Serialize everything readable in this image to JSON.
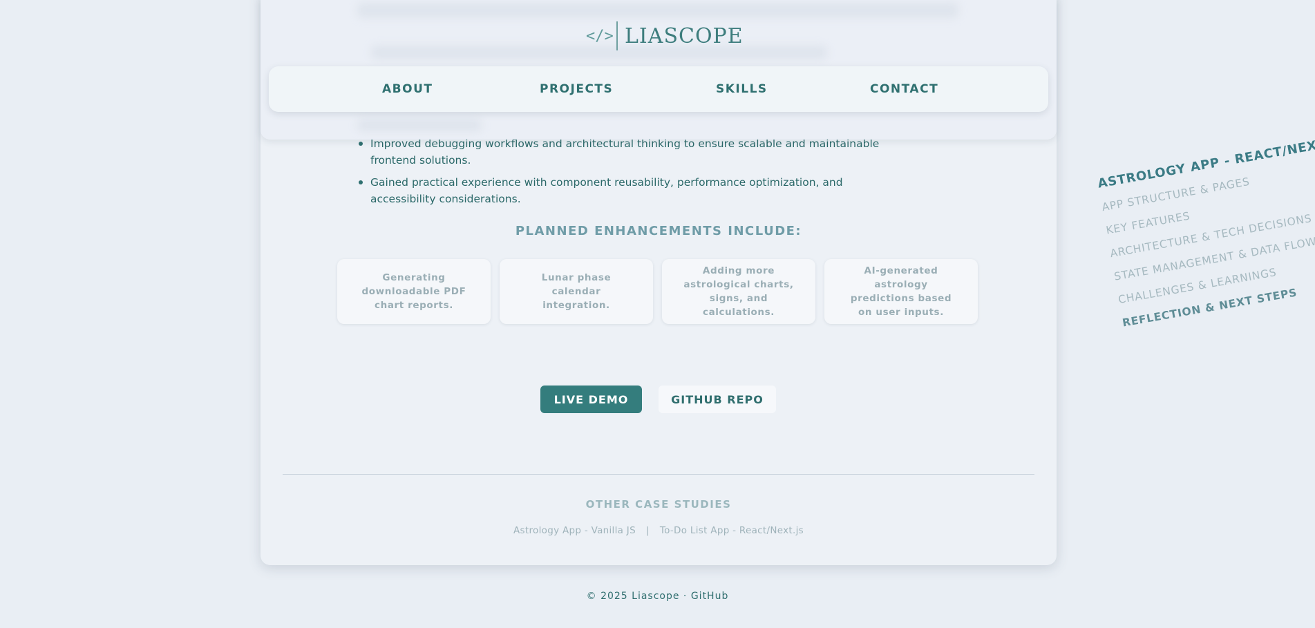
{
  "header": {
    "logo_icon": "</>",
    "logo_text": "LIASCOPE"
  },
  "nav": {
    "items": [
      {
        "label": "ABOUT"
      },
      {
        "label": "PROJECTS"
      },
      {
        "label": "SKILLS"
      },
      {
        "label": "CONTACT"
      }
    ]
  },
  "content": {
    "bullets": [
      "Improved debugging workflows and architectural thinking to ensure scalable and maintainable frontend solutions.",
      "Gained practical experience with component reusability, performance optimization, and accessibility considerations."
    ],
    "enhancements_heading": "PLANNED ENHANCEMENTS INCLUDE:",
    "enhancements": [
      "Generating downloadable PDF chart reports.",
      "Lunar phase calendar integration.",
      "Adding more astrological charts, signs, and calculations.",
      "AI-generated astrology predictions based on user inputs."
    ],
    "buttons": {
      "live_demo": "LIVE DEMO",
      "github_repo": "GITHUB REPO"
    }
  },
  "other_case_studies": {
    "title": "OTHER CASE STUDIES",
    "separator": "|",
    "links": [
      "Astrology App - Vanilla JS",
      "To-Do List App - React/Next.js"
    ]
  },
  "footer": {
    "text": "© 2025 Liascope · GitHub"
  },
  "toc": {
    "title": "ASTROLOGY APP - REACT/NEXT.JS",
    "items": [
      "APP STRUCTURE & PAGES",
      "KEY FEATURES",
      "ARCHITECTURE & TECH DECISIONS",
      "STATE MANAGEMENT & DATA FLOW",
      "CHALLENGES & LEARNINGS",
      "REFLECTION & NEXT STEPS"
    ],
    "active_index": 5
  },
  "colors": {
    "accent": "#347d7d",
    "background": "#e9eef4",
    "card": "#edf1f6"
  }
}
